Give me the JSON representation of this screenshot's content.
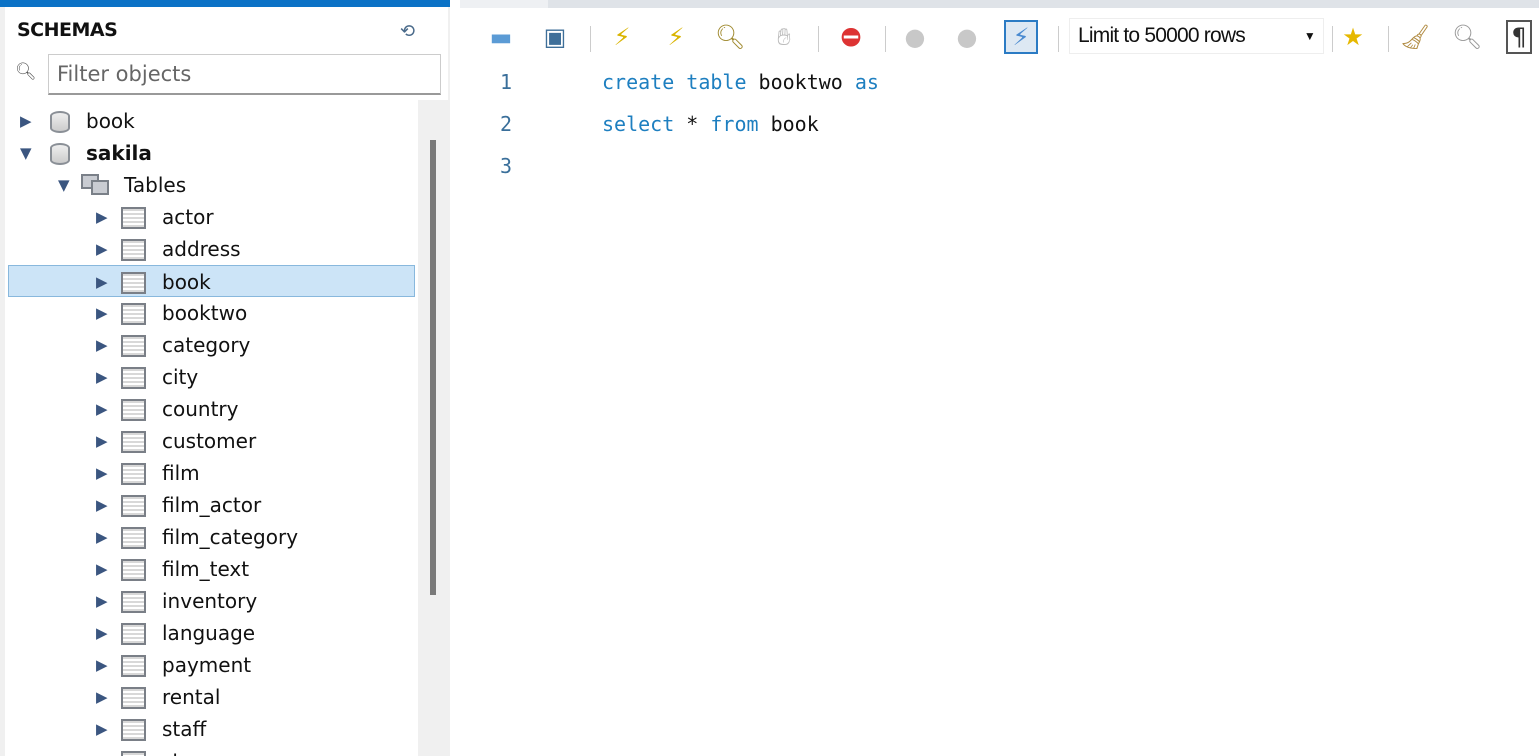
{
  "sidebar": {
    "title": "SCHEMAS",
    "filter_placeholder": "Filter objects",
    "schemas": [
      {
        "label": "book",
        "expanded": false
      },
      {
        "label": "sakila",
        "expanded": true
      }
    ],
    "tables_group": "Tables",
    "tables": [
      "actor",
      "address",
      "book",
      "booktwo",
      "category",
      "city",
      "country",
      "customer",
      "film",
      "film_actor",
      "film_category",
      "film_text",
      "inventory",
      "language",
      "payment",
      "rental",
      "staff",
      "store"
    ],
    "selected_table": "book"
  },
  "toolbar": {
    "limit_label": "Limit to 50000 rows"
  },
  "editor": {
    "lines": [
      {
        "num": "1",
        "tokens": [
          {
            "t": "create",
            "kw": true
          },
          {
            "t": " "
          },
          {
            "t": "table",
            "kw": true
          },
          {
            "t": " booktwo "
          },
          {
            "t": "as",
            "kw": true
          }
        ]
      },
      {
        "num": "2",
        "tokens": [
          {
            "t": "select",
            "kw": true
          },
          {
            "t": " * "
          },
          {
            "t": "from",
            "kw": true
          },
          {
            "t": " book"
          }
        ]
      },
      {
        "num": "3",
        "tokens": []
      }
    ]
  },
  "colors": {
    "accent": "#0b72c6",
    "keyword": "#1e7fc0",
    "selection": "#cce4f7"
  }
}
